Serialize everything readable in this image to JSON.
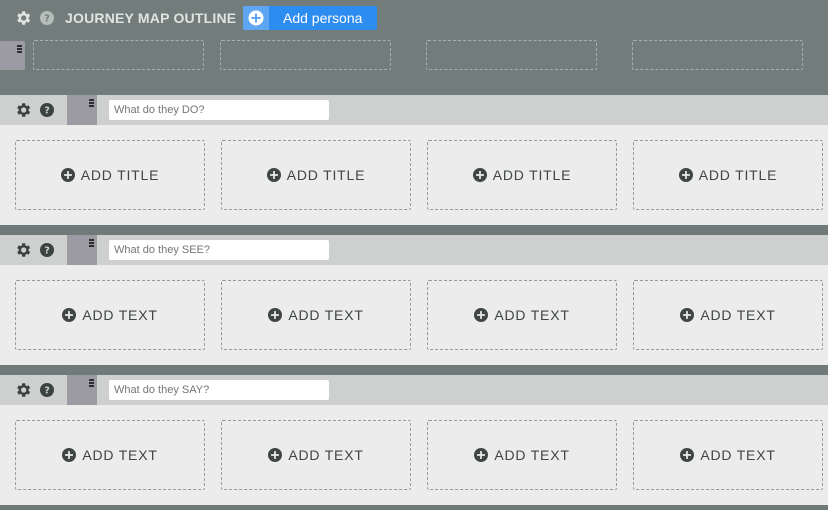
{
  "header": {
    "title": "JOURNEY MAP OUTLINE",
    "add_persona_label": "Add persona",
    "persona_slots": 4
  },
  "sections": [
    {
      "placeholder": "What do they DO?",
      "card_label": "ADD TITLE"
    },
    {
      "placeholder": "What do they SEE?",
      "card_label": "ADD TEXT"
    },
    {
      "placeholder": "What do they SAY?",
      "card_label": "ADD TEXT"
    }
  ],
  "icons": {
    "settings": "gear-icon",
    "help": "question-icon",
    "add": "plus-circle-icon",
    "drag": "drag-handle-icon"
  },
  "colors": {
    "accent": "#2d8cf0",
    "header_bg": "#727d7b",
    "section_bar": "#ced0cf",
    "section_body": "#ececec"
  }
}
